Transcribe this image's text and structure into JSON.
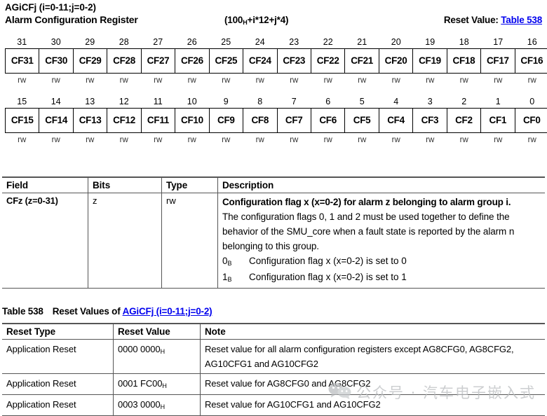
{
  "register": {
    "name": "AGiCFj (i=0-11;j=0-2)",
    "long_name": "Alarm Configuration Register",
    "offset_prefix": "(100",
    "offset_sub": "H",
    "offset_suffix": "+i*12+j*4)",
    "reset_label": "Reset Value: ",
    "reset_link": "Table 538"
  },
  "bit_table": {
    "rows": [
      {
        "numbers": [
          "31",
          "30",
          "29",
          "28",
          "27",
          "26",
          "25",
          "24",
          "23",
          "22",
          "21",
          "20",
          "19",
          "18",
          "17",
          "16"
        ],
        "fields": [
          "CF31",
          "CF30",
          "CF29",
          "CF28",
          "CF27",
          "CF26",
          "CF25",
          "CF24",
          "CF23",
          "CF22",
          "CF21",
          "CF20",
          "CF19",
          "CF18",
          "CF17",
          "CF16"
        ],
        "access": [
          "rw",
          "rw",
          "rw",
          "rw",
          "rw",
          "rw",
          "rw",
          "rw",
          "rw",
          "rw",
          "rw",
          "rw",
          "rw",
          "rw",
          "rw",
          "rw"
        ]
      },
      {
        "numbers": [
          "15",
          "14",
          "13",
          "12",
          "11",
          "10",
          "9",
          "8",
          "7",
          "6",
          "5",
          "4",
          "3",
          "2",
          "1",
          "0"
        ],
        "fields": [
          "CF15",
          "CF14",
          "CF13",
          "CF12",
          "CF11",
          "CF10",
          "CF9",
          "CF8",
          "CF7",
          "CF6",
          "CF5",
          "CF4",
          "CF3",
          "CF2",
          "CF1",
          "CF0"
        ],
        "access": [
          "rw",
          "rw",
          "rw",
          "rw",
          "rw",
          "rw",
          "rw",
          "rw",
          "rw",
          "rw",
          "rw",
          "rw",
          "rw",
          "rw",
          "rw",
          "rw"
        ]
      }
    ]
  },
  "field_table": {
    "headers": {
      "field": "Field",
      "bits": "Bits",
      "type": "Type",
      "description": "Description"
    },
    "rows": [
      {
        "field": "CFz (z=0-31)",
        "bits": "z",
        "type": "rw",
        "desc_title": "Configuration flag x (x=0-2) for alarm z belonging to alarm group i.",
        "desc_body": "The configuration flags 0, 1 and 2 must be used together to define the behavior of the SMU_core when a fault state is reported by the alarm n belonging to this group.",
        "enums": [
          {
            "key": "0",
            "key_sub": "B",
            "text": "Configuration flag x (x=0-2) is set to 0"
          },
          {
            "key": "1",
            "key_sub": "B",
            "text": "Configuration flag x (x=0-2) is set to 1"
          }
        ]
      }
    ]
  },
  "reset_table": {
    "caption_number": "Table 538",
    "caption_text": "Reset Values of ",
    "caption_link": "AGiCFj (i=0-11;j=0-2)",
    "headers": {
      "reset_type": "Reset Type",
      "reset_value": "Reset Value",
      "note": "Note"
    },
    "rows": [
      {
        "reset_type": "Application Reset",
        "reset_value": "0000 0000",
        "reset_value_sub": "H",
        "note": "Reset value for all alarm configuration registers except AG8CFG0, AG8CFG2, AG10CFG1 and AG10CFG2"
      },
      {
        "reset_type": "Application Reset",
        "reset_value": "0001 FC00",
        "reset_value_sub": "H",
        "note": "Reset value for AG8CFG0 and AG8CFG2"
      },
      {
        "reset_type": "Application Reset",
        "reset_value": "0003 0000",
        "reset_value_sub": "H",
        "note": "Reset value for AG10CFG1 and AG10CFG2"
      }
    ]
  },
  "watermark": {
    "text": "公众号 · 汽车电子嵌入式",
    "icon": "wechat-icon",
    "color": "#b9bcbe"
  }
}
